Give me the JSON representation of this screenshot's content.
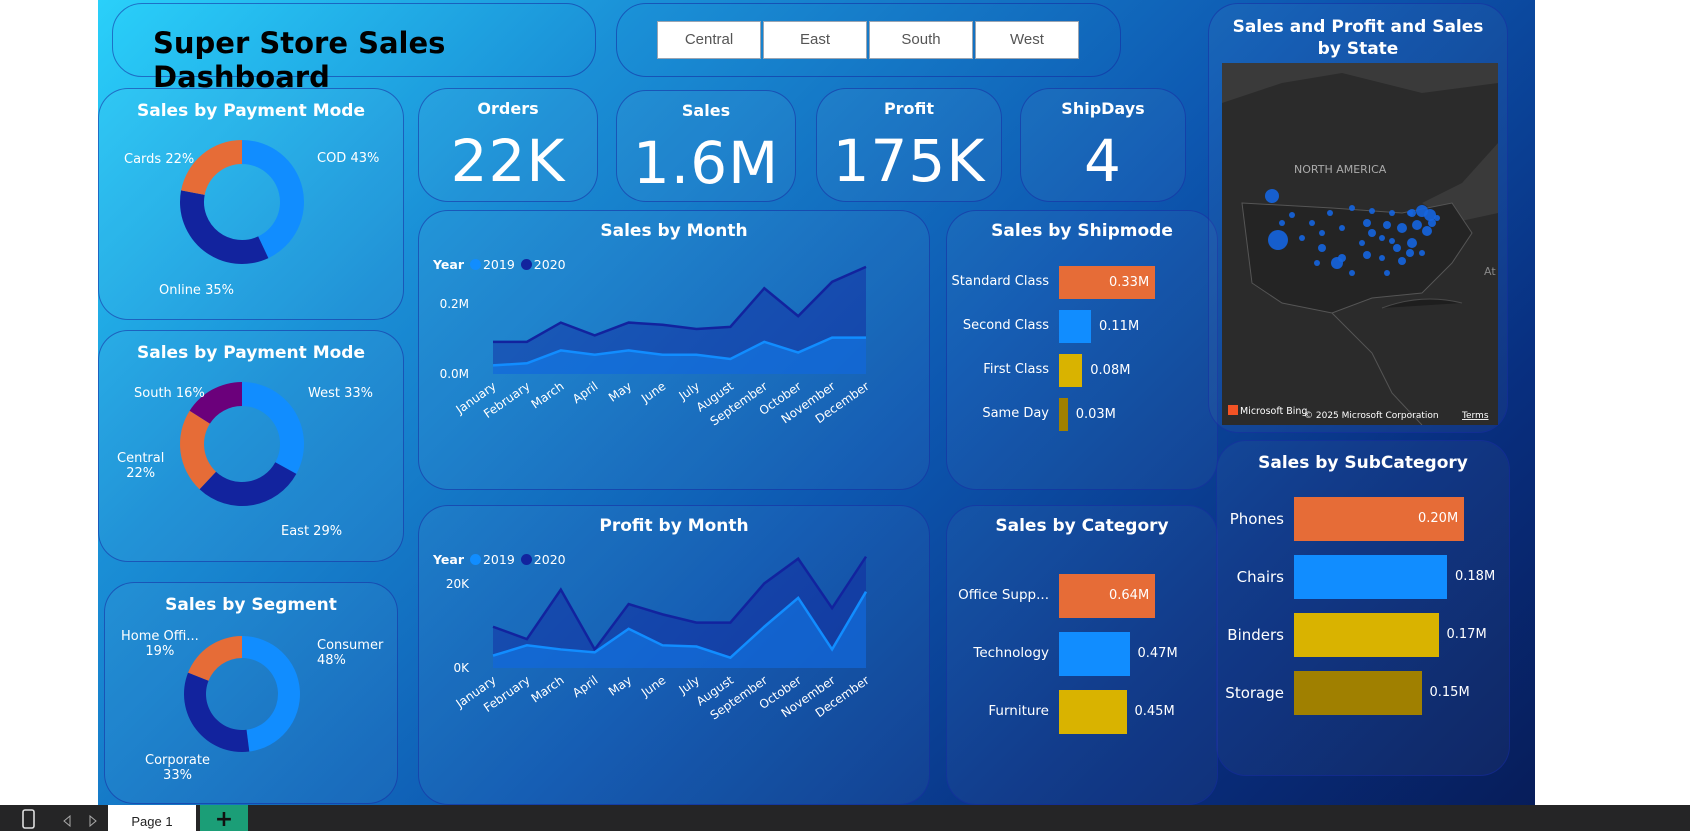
{
  "header": {
    "title": "Super Store Sales Dashboard"
  },
  "region_slicer": [
    "Central",
    "East",
    "South",
    "West"
  ],
  "kpis": [
    {
      "label": "Orders",
      "value": "22K"
    },
    {
      "label": "Sales",
      "value": "1.6M"
    },
    {
      "label": "Profit",
      "value": "175K"
    },
    {
      "label": "ShipDays",
      "value": "4"
    }
  ],
  "payment_mode": {
    "title": "Sales by Payment Mode",
    "slices": [
      {
        "label": "COD 43%",
        "value": 43,
        "color": "#118dff"
      },
      {
        "label": "Online 35%",
        "value": 35,
        "color": "#12239e"
      },
      {
        "label": "Cards 22%",
        "value": 22,
        "color": "#e66c37"
      }
    ]
  },
  "region_mode": {
    "title": "Sales by Payment Mode",
    "slices": [
      {
        "label": "West 33%",
        "value": 33,
        "color": "#118dff"
      },
      {
        "label": "East 29%",
        "value": 29,
        "color": "#12239e"
      },
      {
        "label": "Central 22%",
        "label_line1": "Central",
        "label_line2": "22%",
        "value": 22,
        "color": "#e66c37"
      },
      {
        "label": "South 16%",
        "value": 16,
        "color": "#6b007b"
      }
    ]
  },
  "segment": {
    "title": "Sales by Segment",
    "slices": [
      {
        "label": "Consumer 48%",
        "label_line1": "Consumer",
        "label_line2": "48%",
        "value": 48,
        "color": "#118dff"
      },
      {
        "label": "Corporate 33%",
        "label_line1": "Corporate",
        "label_line2": "33%",
        "value": 33,
        "color": "#12239e"
      },
      {
        "label": "Home Offi... 19%",
        "label_line1": "Home Offi...",
        "label_line2": "19%",
        "value": 19,
        "color": "#e66c37"
      }
    ]
  },
  "legend": {
    "title": "Year",
    "items": [
      {
        "name": "2019",
        "color": "#118dff"
      },
      {
        "name": "2020",
        "color": "#12239e"
      }
    ]
  },
  "sales_by_month": {
    "title": "Sales by Month",
    "chart_data": {
      "type": "area",
      "categories": [
        "January",
        "February",
        "March",
        "April",
        "May",
        "June",
        "July",
        "August",
        "September",
        "October",
        "November",
        "December"
      ],
      "series": [
        {
          "name": "2019",
          "values": [
            0.02,
            0.025,
            0.055,
            0.045,
            0.055,
            0.045,
            0.045,
            0.035,
            0.075,
            0.05,
            0.085,
            0.085
          ]
        },
        {
          "name": "2020",
          "values": [
            0.075,
            0.075,
            0.12,
            0.09,
            0.12,
            0.115,
            0.105,
            0.11,
            0.2,
            0.135,
            0.215,
            0.25
          ]
        }
      ],
      "yticks": [
        "0.0M",
        "0.2M"
      ],
      "ylim": [
        0,
        0.28
      ]
    }
  },
  "profit_by_month": {
    "title": "Profit by Month",
    "chart_data": {
      "type": "area",
      "categories": [
        "January",
        "February",
        "March",
        "April",
        "May",
        "June",
        "July",
        "August",
        "September",
        "October",
        "November",
        "December"
      ],
      "series": [
        {
          "name": "2019",
          "values": [
            3000,
            5500,
            4500,
            3800,
            9500,
            5500,
            5200,
            2500,
            10000,
            17000,
            4500,
            18500
          ]
        },
        {
          "name": "2020",
          "values": [
            10000,
            7000,
            19000,
            4500,
            15500,
            13000,
            11000,
            11000,
            20500,
            26500,
            14500,
            27000
          ]
        }
      ],
      "yticks": [
        "0K",
        "20K"
      ],
      "ylim": [
        0,
        32000
      ]
    }
  },
  "shipmode": {
    "title": "Sales by Shipmode",
    "chart_data": {
      "type": "bar",
      "categories": [
        "Standard Class",
        "Second Class",
        "First Class",
        "Same Day"
      ],
      "values": [
        0.33,
        0.11,
        0.08,
        0.03
      ],
      "labels": [
        "0.33M",
        "0.11M",
        "0.08M",
        "0.03M"
      ],
      "colors": [
        "#e66c37",
        "#118dff",
        "#d9b300",
        "#a08000"
      ]
    }
  },
  "category": {
    "title": "Sales by Category",
    "chart_data": {
      "type": "bar",
      "categories": [
        "Office Supp...",
        "Technology",
        "Furniture"
      ],
      "values": [
        0.64,
        0.47,
        0.45
      ],
      "labels": [
        "0.64M",
        "0.47M",
        "0.45M"
      ],
      "colors": [
        "#e66c37",
        "#118dff",
        "#d9b300"
      ]
    }
  },
  "subcategory": {
    "title": "Sales by SubCategory",
    "chart_data": {
      "type": "bar",
      "categories": [
        "Phones",
        "Chairs",
        "Binders",
        "Storage"
      ],
      "values": [
        0.2,
        0.18,
        0.17,
        0.15
      ],
      "labels": [
        "0.20M",
        "0.18M",
        "0.17M",
        "0.15M"
      ],
      "colors": [
        "#e66c37",
        "#118dff",
        "#d9b300",
        "#a08000"
      ]
    }
  },
  "map": {
    "title": "Sales and Profit and Sales by State",
    "region_label": "NORTH AMERICA",
    "edge_label": "At",
    "bing": "Microsoft Bing",
    "copyright": "© 2025 Microsoft Corporation",
    "terms": "Terms"
  },
  "footer": {
    "page_tab": "Page 1",
    "add_icon": "+"
  }
}
